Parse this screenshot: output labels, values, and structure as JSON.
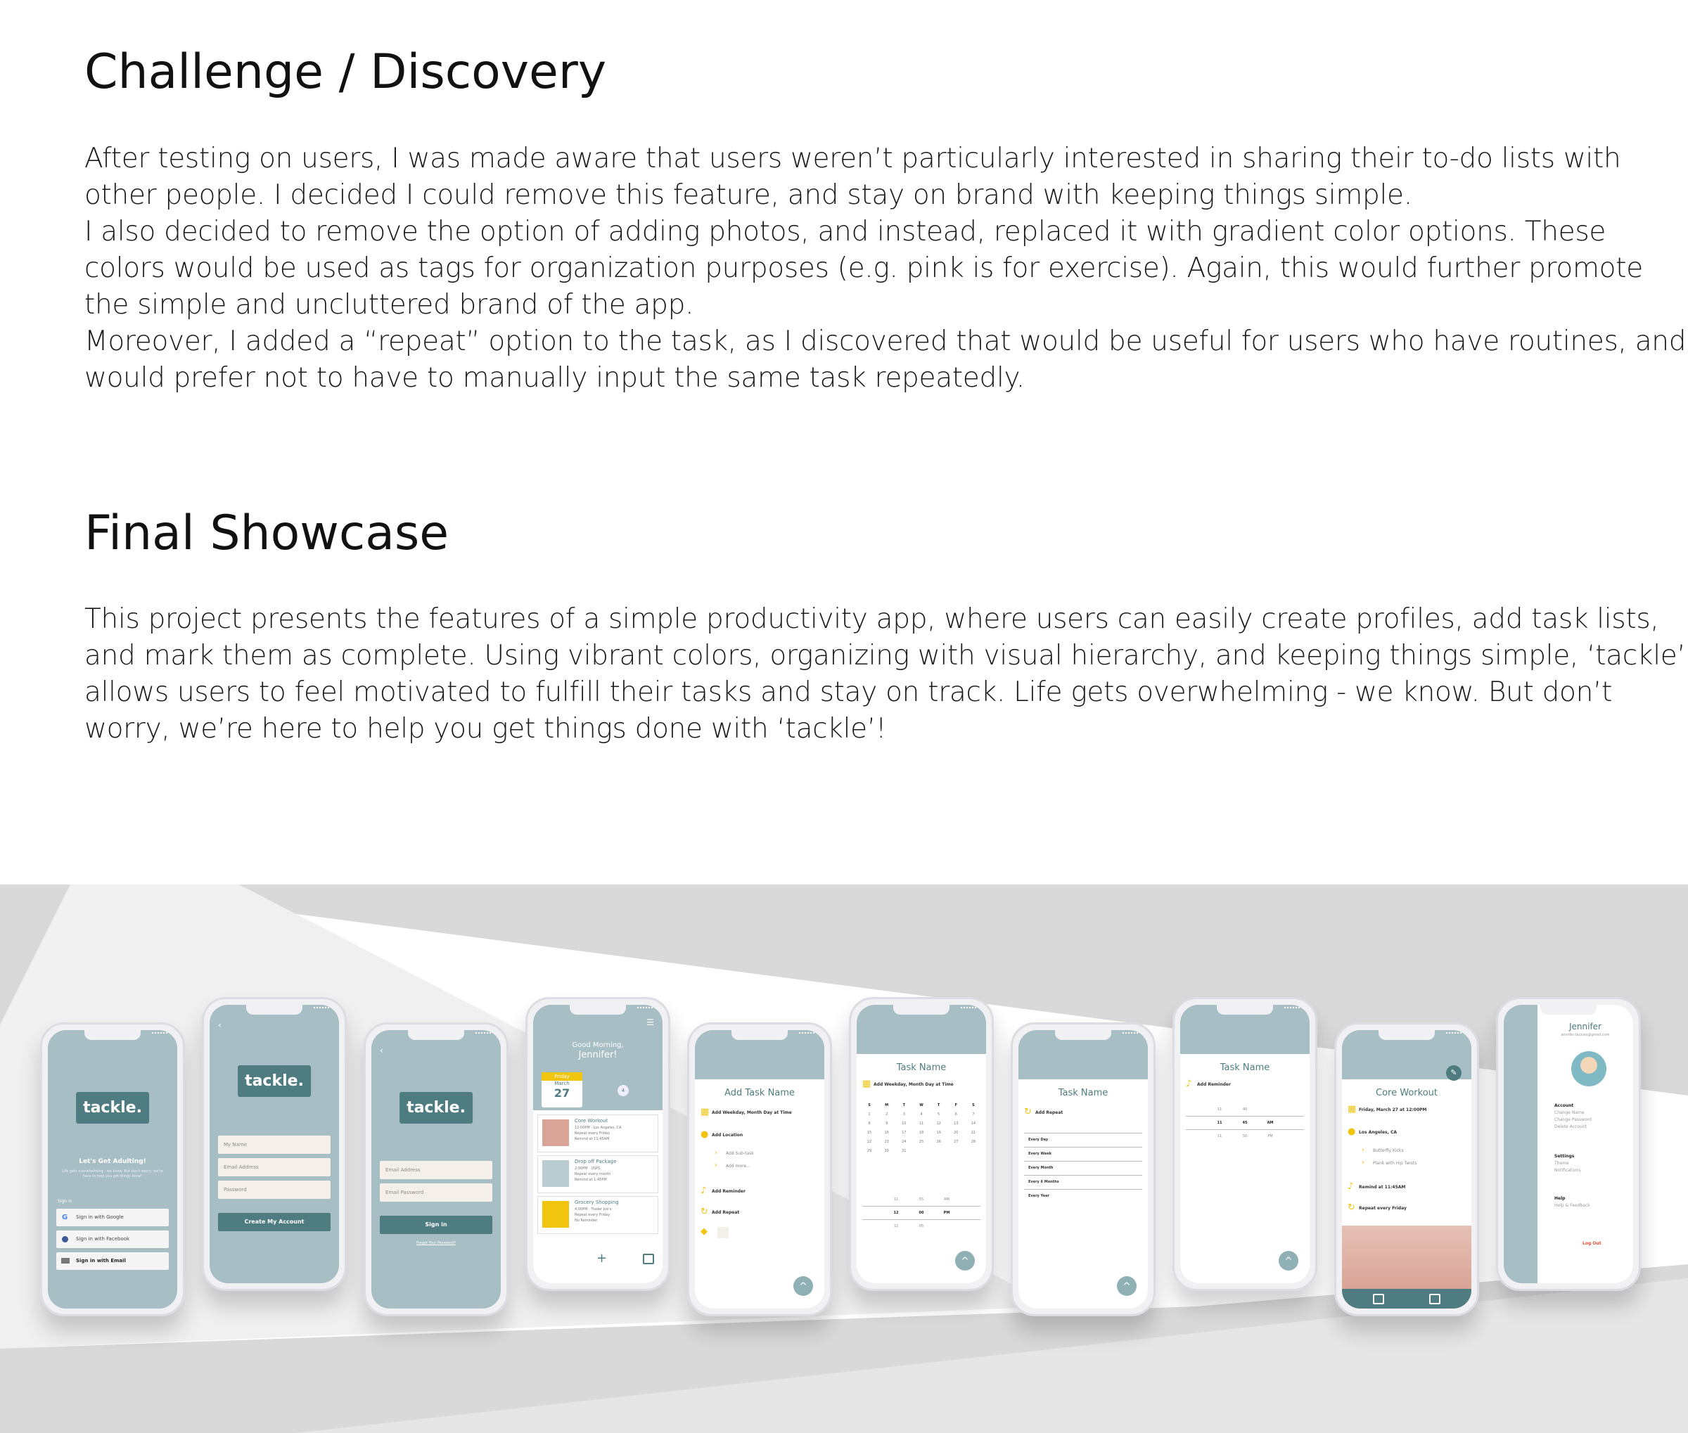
{
  "challenge": {
    "heading": "Challenge / Discovery",
    "lines": [
      "After testing on users, I was made aware that users weren’t particularly interested in sharing their to-do lists with",
      "other people. I decided I could remove this feature, and stay on brand with keeping things simple.",
      "I also decided to remove the option of adding photos, and instead, replaced it with gradient color options. These",
      "colors would be used as tags for organization purposes (e.g. pink is for exercise). Again, this would further promote",
      "the simple and uncluttered brand of the app.",
      "Moreover, I added a “repeat” option to the task, as I discovered that would be useful for users who have routines, and",
      "would prefer not to have to manually input the same task repeatedly."
    ]
  },
  "final": {
    "heading": "Final Showcase",
    "lines": [
      "This project presents the features of a simple productivity app, where users can easily create profiles, add task lists,",
      "and mark them as complete. Using vibrant colors, organizing with visual hierarchy, and keeping things simple, ‘tackle’",
      "allows users to feel motivated to fulfill their tasks and stay on track. Life gets overwhelming - we know. But don’t",
      "worry, we’re here to help you get things done with ‘tackle’!"
    ]
  },
  "phones": {
    "p1": {
      "logo": "tackle.",
      "headline": "Let's Get Adulting!",
      "blurb": "Life gets overwhelming - we know. But don't worry, we're here to help you get things done!",
      "signin": "Sign in",
      "google": "Sign in with Google",
      "facebook": "Sign in with Facebook",
      "email": "Sign in with Email"
    },
    "p2": {
      "logo": "tackle.",
      "name": "My Name",
      "email": "Email Address",
      "password": "Password",
      "create": "Create My Account"
    },
    "p3": {
      "logo": "tackle.",
      "email": "Email Address",
      "password": "Email Password",
      "signin": "Sign in",
      "forgot": "Forgot Your Password?"
    },
    "p4": {
      "greeting1": "Good Morning,",
      "greeting2": "Jennifer!",
      "day": "Friday",
      "month": "March",
      "date": "27",
      "count": "4",
      "tasks": [
        {
          "name": "Core Workout",
          "l1": "12:00PM · Los Angeles, CA",
          "l2": "Repeat every Friday",
          "l3": "Remind at 11:45AM"
        },
        {
          "name": "Drop off Package",
          "l1": "2:00PM · USPS",
          "l2": "Repeat every month",
          "l3": "Remind at 1:45PM"
        },
        {
          "name": "Grocery Shopping",
          "l1": "4:00PM · Trader Joe's",
          "l2": "Repeat every Friday",
          "l3": "No Reminder"
        }
      ]
    },
    "p5": {
      "title": "Add Task Name",
      "when": "Add Weekday, Month Day at Time",
      "location": "Add Location",
      "subtask": "Add Sub-task",
      "more": "Add more...",
      "reminder": "Add Reminder",
      "repeat": "Add Repeat"
    },
    "p6": {
      "title": "Task Name",
      "when": "Add Weekday, Month Day at Time",
      "dow": [
        "S",
        "M",
        "T",
        "W",
        "T",
        "F",
        "S"
      ],
      "weeks": [
        [
          "1",
          "2",
          "3",
          "4",
          "5",
          "6",
          "7"
        ],
        [
          "8",
          "9",
          "10",
          "11",
          "12",
          "13",
          "14"
        ],
        [
          "15",
          "16",
          "17",
          "18",
          "19",
          "20",
          "21"
        ],
        [
          "22",
          "23",
          "24",
          "25",
          "26",
          "27",
          "28"
        ],
        [
          "29",
          "30",
          "31",
          "",
          "",
          "",
          ""
        ]
      ],
      "times": [
        [
          "11",
          "55",
          "AM"
        ],
        [
          "12",
          "00",
          "PM"
        ],
        [
          "12",
          "05",
          ""
        ]
      ]
    },
    "p7": {
      "title": "Task Name",
      "repeat": "Add Repeat",
      "options": [
        "Every Day",
        "Every Week",
        "Every Month",
        "Every 6 Months",
        "Every Year"
      ]
    },
    "p8": {
      "title": "Task Name",
      "reminder": "Add Reminder",
      "times": [
        [
          "11",
          "40",
          ""
        ],
        [
          "11",
          "45",
          "AM"
        ],
        [
          "11",
          "50",
          "PM"
        ]
      ]
    },
    "p9": {
      "title": "Core Workout",
      "when": "Friday, March 27 at 12:00PM",
      "location": "Los Angeles, CA",
      "sub1": "Butterfly Kicks",
      "sub2": "Plank with Hip Twists",
      "reminder": "Remind at 11:45AM",
      "repeat": "Repeat every Friday"
    },
    "p10": {
      "name": "Jennifer",
      "email": "jennifer.tackles@gmail.com",
      "account": "Account",
      "change_name": "Change Name",
      "change_password": "Change Password",
      "delete": "Delete Account",
      "settings": "Settings",
      "theme": "Theme",
      "notifications": "Notifications",
      "help": "Help",
      "feedback": "Help & Feedback",
      "logout": "Log Out"
    }
  },
  "colors": {
    "teal": "#a7bfc4",
    "dark_teal": "#4e7c80",
    "yellow": "#f1c40f",
    "pink": "#d9a397",
    "red": "#e74c3c"
  }
}
